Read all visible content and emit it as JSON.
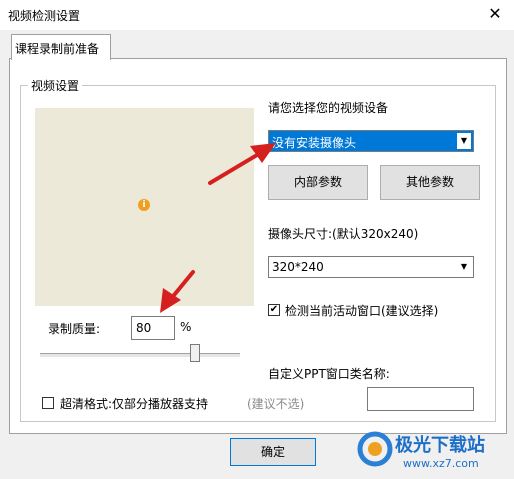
{
  "window": {
    "title": "视频检测设置",
    "close_glyph": "✕"
  },
  "tabs": [
    {
      "label": "课程录制前准备"
    }
  ],
  "video_group": {
    "caption": "视频设置"
  },
  "device": {
    "prompt": "请您选择您的视频设备",
    "selected": "没有安装摄像头",
    "internal_button": "内部参数",
    "other_button": "其他参数"
  },
  "camera_size": {
    "label": "摄像头尺寸:(默认320x240)",
    "selected": "320*240"
  },
  "detect_window": {
    "checked": true,
    "label": "检测当前活动窗口(建议选择)"
  },
  "quality": {
    "label": "录制质量:",
    "value": "80",
    "unit": "%",
    "slider_level": 0.8
  },
  "ppt": {
    "label": "自定义PPT窗口类名称:",
    "value": ""
  },
  "hd_format": {
    "checked": false,
    "label": "超清格式:仅部分播放器支持",
    "hint": "(建议不选)"
  },
  "ok_button": "确定",
  "watermark": {
    "brand": "极光下载站",
    "url": "www.xz7.com"
  },
  "icons": {
    "info": "i",
    "dropdown": "▼",
    "check": "✔"
  },
  "colors": {
    "selection": "#0078d7",
    "arrow": "#d62020",
    "preview_bg": "#ece9d8"
  }
}
